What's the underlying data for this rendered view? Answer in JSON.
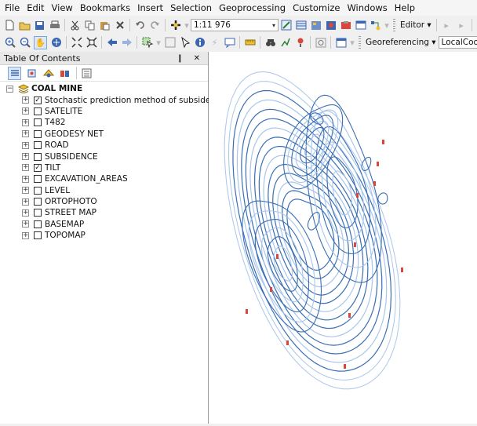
{
  "menubar": {
    "items": [
      "File",
      "Edit",
      "View",
      "Bookmarks",
      "Insert",
      "Selection",
      "Geoprocessing",
      "Customize",
      "Windows",
      "Help"
    ]
  },
  "toolbar": {
    "scale_value": "1:11 976",
    "georeferencing_label": "Georeferencing ▾",
    "georef_layer_value": "LocalCoordSystem_EA.dwg Polyl",
    "editor_label": "Editor ▾"
  },
  "toc": {
    "title": "Table Of Contents",
    "pin_close": "❙ ✕",
    "group": {
      "name": "COAL MINE",
      "expanded": true
    },
    "layers": [
      {
        "name": "Stochastic prediction method of subsidence",
        "checked": true
      },
      {
        "name": "SATELITE",
        "checked": false
      },
      {
        "name": "T482",
        "checked": false
      },
      {
        "name": "GEODESY NET",
        "checked": false
      },
      {
        "name": "ROAD",
        "checked": false
      },
      {
        "name": "SUBSIDENCE",
        "checked": false
      },
      {
        "name": "TILT",
        "checked": true
      },
      {
        "name": "EXCAVATION_AREAS",
        "checked": false
      },
      {
        "name": "LEVEL",
        "checked": false
      },
      {
        "name": "ORTOPHOTO",
        "checked": false
      },
      {
        "name": "STREET MAP",
        "checked": false
      },
      {
        "name": "BASEMAP",
        "checked": false
      },
      {
        "name": "TOPOMAP",
        "checked": false
      }
    ]
  },
  "colors": {
    "contour_dark": "#3a6fb5",
    "contour_light": "#a9c6ea",
    "label_red": "#d9463a"
  }
}
